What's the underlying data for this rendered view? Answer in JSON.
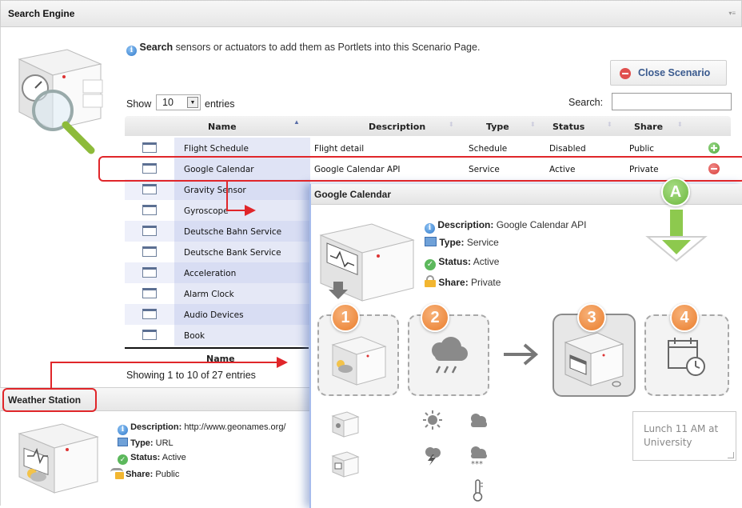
{
  "panel": {
    "title": "Search Engine",
    "menu_icon": "▾≡"
  },
  "intro": {
    "bold": "Search",
    "text": " sensors or actuators to add them as Portlets into this Scenario Page."
  },
  "close_button": {
    "label": "Close Scenario"
  },
  "entries": {
    "show": "Show",
    "value": "10",
    "suffix": "entries"
  },
  "search": {
    "label": "Search:",
    "placeholder": ""
  },
  "table": {
    "headers": {
      "name": "Name",
      "description": "Description",
      "type": "Type",
      "status": "Status",
      "share": "Share"
    },
    "rows": [
      {
        "name": "Flight Schedule",
        "description": "Flight detail",
        "type": "Schedule",
        "status": "Disabled",
        "share": "Public",
        "action": "add"
      },
      {
        "name": "Google Calendar",
        "description": "Google Calendar API",
        "type": "Service",
        "status": "Active",
        "share": "Private",
        "action": "remove"
      },
      {
        "name": "Gravity Sensor"
      },
      {
        "name": "Gyroscope"
      },
      {
        "name": "Deutsche Bahn Service"
      },
      {
        "name": "Deutsche Bank Service"
      },
      {
        "name": "Acceleration"
      },
      {
        "name": "Alarm Clock"
      },
      {
        "name": "Audio Devices"
      },
      {
        "name": "Book"
      }
    ],
    "footer_name": "Name",
    "showing": "Showing 1 to 10 of 27 entries"
  },
  "weather_station": {
    "title": "Weather Station",
    "description_label": "Description:",
    "description": "http://www.geonames.org/",
    "type_label": "Type:",
    "type": "URL",
    "status_label": "Status:",
    "status": "Active",
    "share_label": "Share:",
    "share": "Public"
  },
  "detail": {
    "title": "Google Calendar",
    "description_label": "Description:",
    "description": "Google Calendar API",
    "type_label": "Type:",
    "type": "Service",
    "status_label": "Status:",
    "status": "Active",
    "share_label": "Share:",
    "share": "Private",
    "badges": [
      "1",
      "2",
      "3",
      "4"
    ],
    "badge_a": "A",
    "note": "Lunch 11 AM at University"
  },
  "colors": {
    "accent_red": "#e0262a",
    "badge_orange": "#ea7d2c",
    "badge_green": "#6cb73d",
    "link_blue": "#3a5a8e",
    "name_col_bg": "#dfe3f5"
  }
}
